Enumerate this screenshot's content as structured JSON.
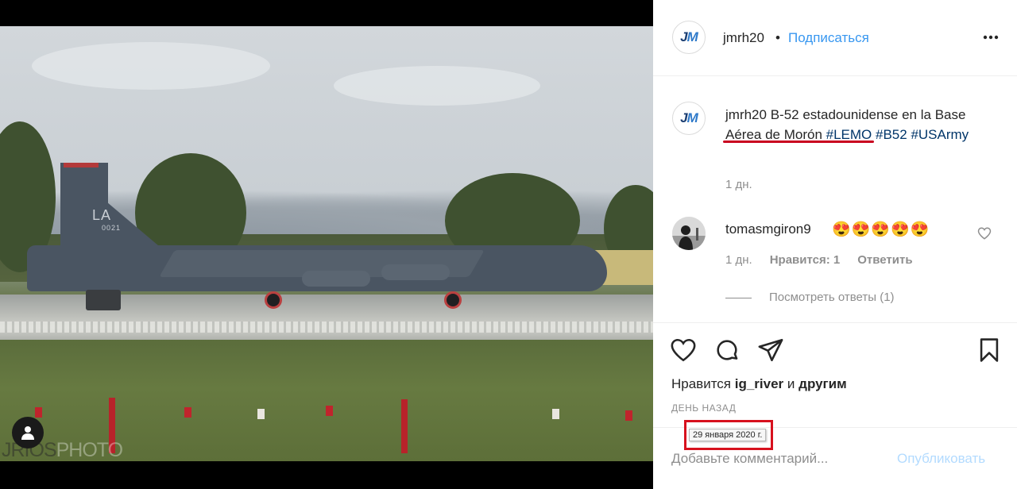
{
  "photo": {
    "watermark_part1": "JRIOS",
    "watermark_part2": "PHOTO",
    "tail_code": "LA",
    "tail_number": "0021"
  },
  "header": {
    "avatar_logo_j": "J",
    "avatar_logo_m": "M",
    "username": "jmrh20",
    "separator": "•",
    "follow_label": "Подписаться",
    "more_icon": "more-horizontal-icon"
  },
  "caption": {
    "username": "jmrh20",
    "text_prefix": "B-52 estadounidense en la",
    "place": "Base Aérea de Morón",
    "hashtags": [
      "#LEMO",
      "#B52",
      "#USArmy"
    ],
    "time": "1 дн."
  },
  "comments": [
    {
      "username": "tomasmgiron9",
      "text": "😍😍😍😍😍",
      "time": "1 дн.",
      "likes": "Нравится: 1",
      "reply_label": "Ответить",
      "view_replies": "Посмотреть ответы (1)"
    }
  ],
  "actions": {
    "like_icon": "heart-icon",
    "comment_icon": "comment-icon",
    "share_icon": "paper-plane-icon",
    "save_icon": "bookmark-icon"
  },
  "likes": {
    "prefix": "Нравится",
    "user": "ig_river",
    "and": "и",
    "others": "другим"
  },
  "post_age": "ДЕНЬ НАЗАД",
  "date_tooltip": "29 января 2020 г.",
  "comment_box": {
    "placeholder": "Добавьте комментарий...",
    "publish_label": "Опубликовать"
  },
  "colors": {
    "link_blue": "#3897f0",
    "hashtag_blue": "#003569",
    "highlight_red": "#d7111e",
    "publish_disabled": "#b3dbff"
  }
}
